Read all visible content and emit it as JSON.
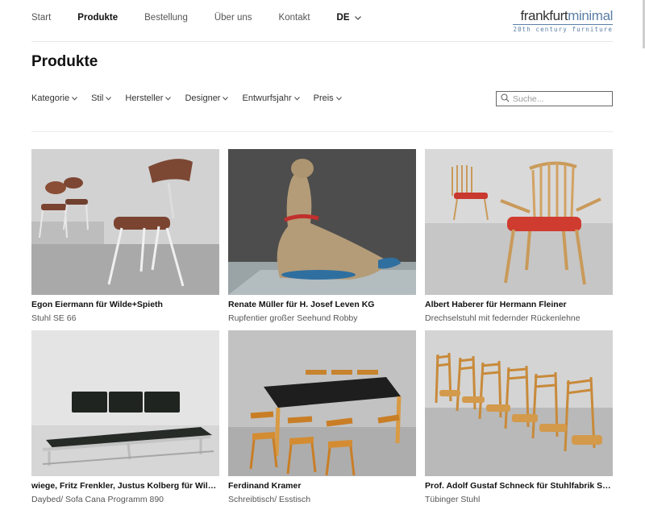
{
  "nav": {
    "items": [
      {
        "label": "Start",
        "active": false
      },
      {
        "label": "Produkte",
        "active": true
      },
      {
        "label": "Bestellung",
        "active": false
      },
      {
        "label": "Über uns",
        "active": false
      },
      {
        "label": "Kontakt",
        "active": false
      }
    ],
    "language": "DE"
  },
  "logo": {
    "part1": "frankfurt",
    "part2": "minimal",
    "tagline": "20th century furniture"
  },
  "page": {
    "title": "Produkte"
  },
  "filters": [
    "Kategorie",
    "Stil",
    "Hersteller",
    "Designer",
    "Entwurfsjahr",
    "Preis"
  ],
  "search": {
    "placeholder": "Suche..."
  },
  "products": [
    {
      "title": "Egon Eiermann für Wilde+Spieth",
      "subtitle": "Stuhl SE 66"
    },
    {
      "title": "Renate Müller für H. Josef Leven KG",
      "subtitle": "Rupfentier großer Seehund Robby"
    },
    {
      "title": "Albert Haberer für Hermann Fleiner",
      "subtitle": "Drechselstuhl mit federnder Rückenlehne"
    },
    {
      "title": "wiege, Fritz Frenkler, Justus Kolberg für Wilkhahn",
      "subtitle": "Daybed/ Sofa Cana Programm 890"
    },
    {
      "title": "Ferdinand Kramer",
      "subtitle": "Schreibtisch/ Esstisch"
    },
    {
      "title": "Prof. Adolf Gustaf Schneck für Stuhlfabrik Schä…",
      "subtitle": "Tübinger Stuhl"
    }
  ],
  "colors": {
    "accent_blue": "#5b7fa6",
    "text_dark": "#111111",
    "text_muted": "#555555"
  }
}
